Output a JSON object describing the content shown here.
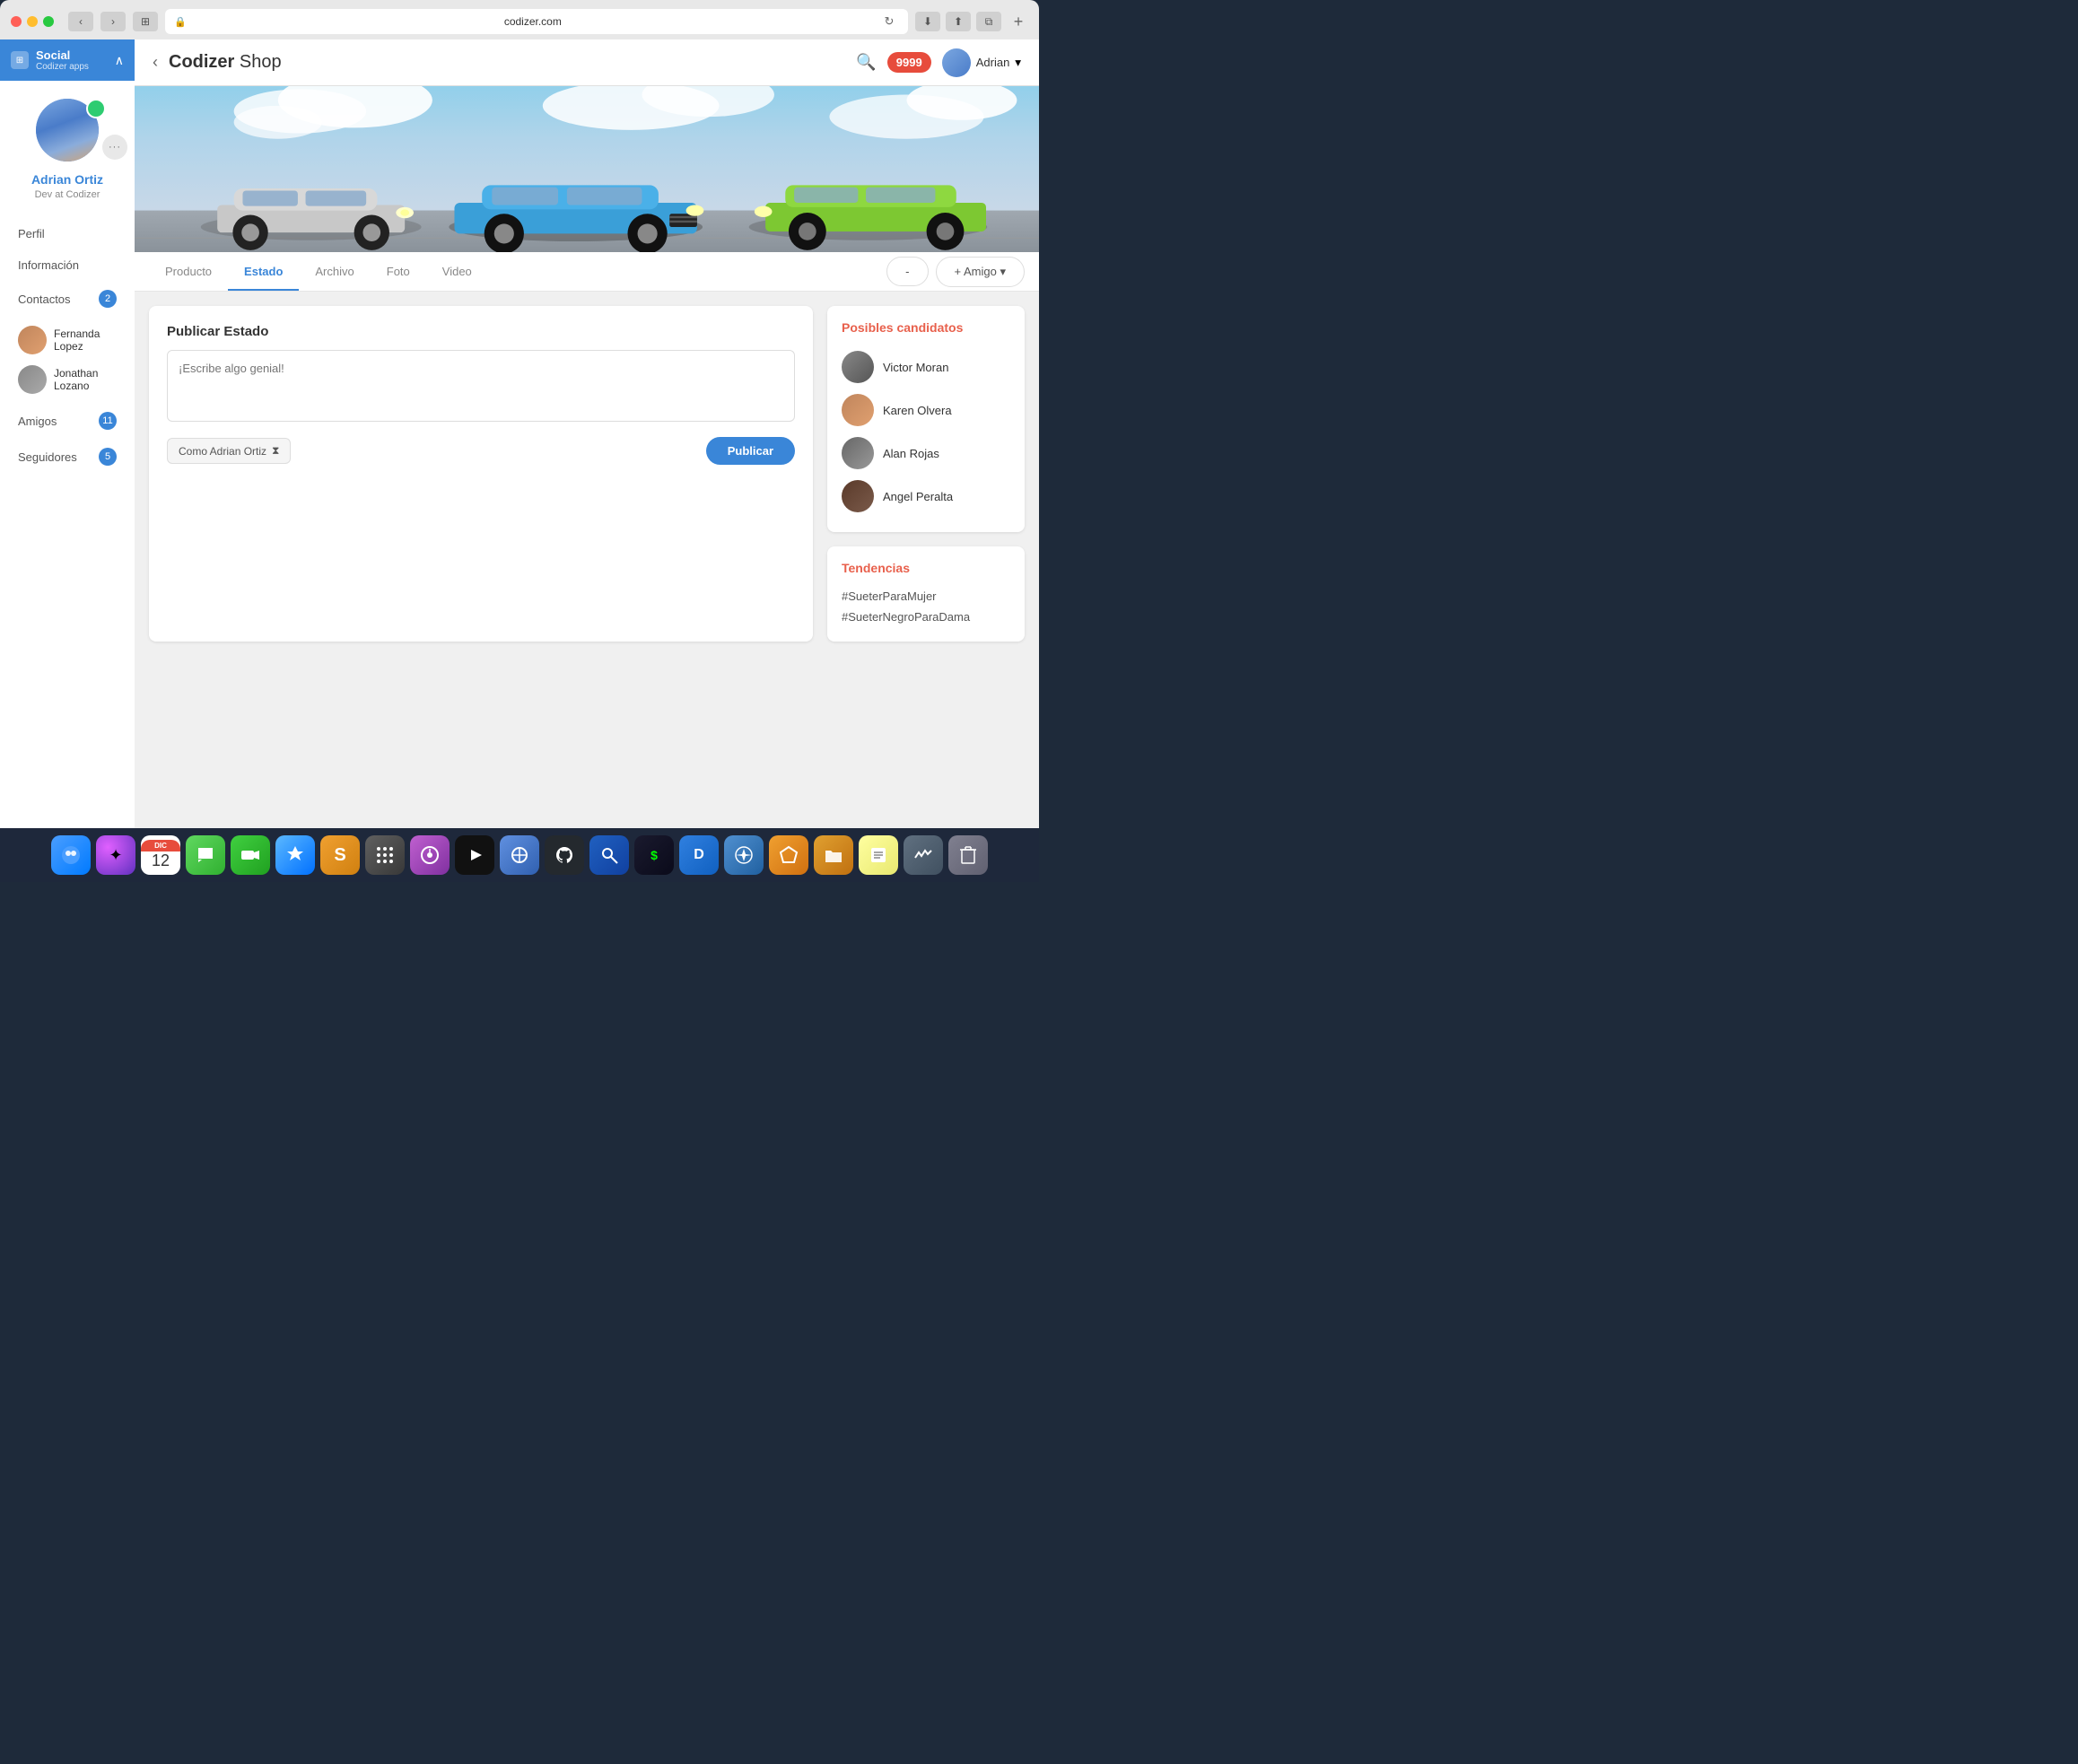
{
  "browser": {
    "url": "codizer.com",
    "url_display": "codizer.com"
  },
  "header": {
    "title_brand": "Codizer",
    "title_rest": " Shop",
    "back_label": "‹",
    "search_label": "🔍",
    "notifications_count": "9999",
    "user_name": "Adrian",
    "user_dropdown": "▾"
  },
  "sidebar": {
    "app_name": "Social",
    "app_subtitle": "Codizer apps",
    "profile_name": "Adrian Ortiz",
    "profile_desc": "Dev at Codizer",
    "nav_items": [
      {
        "label": "Perfil",
        "badge": null
      },
      {
        "label": "Información",
        "badge": null
      },
      {
        "label": "Contactos",
        "badge": "2"
      },
      {
        "label": "Amigos",
        "badge": "11"
      },
      {
        "label": "Seguidores",
        "badge": "5"
      }
    ],
    "contacts": [
      {
        "name": "Fernanda Lopez"
      },
      {
        "name": "Jonathan Lozano"
      }
    ]
  },
  "tabs": {
    "items": [
      {
        "label": "Producto",
        "active": false
      },
      {
        "label": "Estado",
        "active": true
      },
      {
        "label": "Archivo",
        "active": false
      },
      {
        "label": "Foto",
        "active": false
      },
      {
        "label": "Video",
        "active": false
      }
    ],
    "friend_minus": "-",
    "friend_add": "+ Amigo ▾"
  },
  "post_section": {
    "title": "Publicar Estado",
    "placeholder": "¡Escribe algo genial!",
    "post_as_label": "Como Adrian Ortiz",
    "publish_label": "Publicar"
  },
  "right_sidebar": {
    "candidates_title": "Posibles candidatos",
    "candidates": [
      {
        "name": "Victor Moran"
      },
      {
        "name": "Karen Olvera"
      },
      {
        "name": "Alan Rojas"
      },
      {
        "name": "Angel Peralta"
      }
    ],
    "trends_title": "Tendencias",
    "trends": [
      {
        "tag": "#SueterParaMujer"
      },
      {
        "tag": "#SueterNegroParaDama"
      }
    ]
  },
  "dock": {
    "items": [
      "🗂",
      "✦",
      "31",
      "💬",
      "📹",
      "🅐",
      "S",
      "🚀",
      "🎙",
      "▶",
      "◉",
      "⚙",
      "🔑",
      "$",
      "D",
      "🧭",
      "💎",
      "📁",
      "📄",
      "≡",
      "🗑"
    ]
  }
}
